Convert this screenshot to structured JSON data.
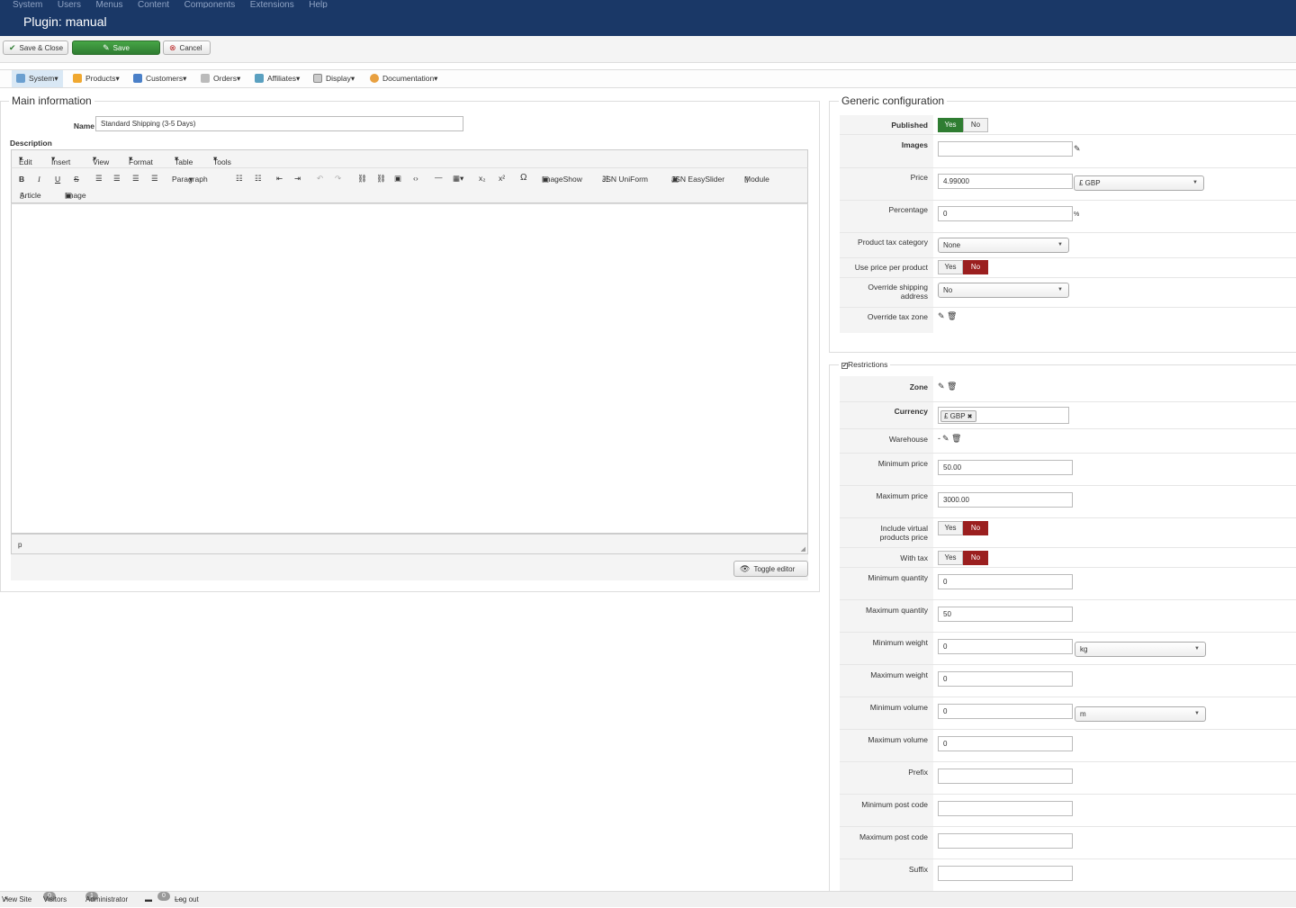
{
  "topmenu": [
    "System",
    "Users",
    "Menus",
    "Content",
    "Components",
    "Extensions",
    "Help"
  ],
  "page_title": "Plugin: manual",
  "toolbar": {
    "save_close": "Save & Close",
    "save": "Save",
    "cancel": "Cancel"
  },
  "submenu": [
    {
      "label": "System",
      "icon": "wrench-icon"
    },
    {
      "label": "Products",
      "icon": "box-icon"
    },
    {
      "label": "Customers",
      "icon": "users-icon"
    },
    {
      "label": "Orders",
      "icon": "orders-icon"
    },
    {
      "label": "Affiliates",
      "icon": "affiliates-icon"
    },
    {
      "label": "Display",
      "icon": "display-icon"
    },
    {
      "label": "Documentation",
      "icon": "documentation-icon"
    }
  ],
  "main": {
    "legend": "Main information",
    "name_label": "Name",
    "name_value": "Standard Shipping (3-5 Days)",
    "description_label": "Description",
    "editor_menu": [
      "Edit",
      "Insert",
      "View",
      "Format",
      "Table",
      "Tools"
    ],
    "editor_block_format": "Paragraph",
    "editor_plugins": [
      "ImageShow",
      "JSN UniForm",
      "JSN EasySlider",
      "Module"
    ],
    "editor_plugins2": [
      "Article",
      "Image"
    ],
    "editor_path": "p",
    "toggle_editor": "Toggle editor"
  },
  "generic": {
    "legend": "Generic configuration",
    "published_label": "Published",
    "yes": "Yes",
    "no": "No",
    "images_label": "Images",
    "price_label": "Price",
    "price_value": "4.99000",
    "price_currency": "£ GBP",
    "percentage_label": "Percentage",
    "percentage_value": "0",
    "percent_sign": "%",
    "tax_category_label": "Product tax category",
    "tax_category_value": "None",
    "use_price_per_product_label": "Use price per product",
    "override_shipping_label_1": "Override shipping",
    "override_shipping_label_2": "address",
    "override_shipping_value": "No",
    "override_tax_zone_label": "Override tax zone"
  },
  "restrictions": {
    "legend": "Restrictions",
    "zone_label": "Zone",
    "currency_label": "Currency",
    "currency_tag": "£ GBP",
    "warehouse_label": "Warehouse",
    "warehouse_value": "-",
    "min_price_label": "Minimum price",
    "min_price_value": "50.00",
    "max_price_label": "Maximum price",
    "max_price_value": "3000.00",
    "include_virtual_label_1": "Include virtual",
    "include_virtual_label_2": "products price",
    "with_tax_label": "With tax",
    "min_qty_label": "Minimum quantity",
    "min_qty_value": "0",
    "max_qty_label": "Maximum quantity",
    "max_qty_value": "50",
    "min_weight_label": "Minimum weight",
    "min_weight_value": "0",
    "weight_unit": "kg",
    "max_weight_label": "Maximum weight",
    "max_weight_value": "0",
    "min_volume_label": "Minimum volume",
    "min_volume_value": "0",
    "volume_unit": "m",
    "max_volume_label": "Maximum volume",
    "max_volume_value": "0",
    "prefix_label": "Prefix",
    "min_postcode_label": "Minimum post code",
    "max_postcode_label": "Maximum post code",
    "suffix_label": "Suffix"
  },
  "statusbar": {
    "view_site": "View Site",
    "visitors_count": "0",
    "visitors": "Visitors",
    "admin_count": "1",
    "administrator": "Administrator",
    "messages_count": "0",
    "logout": "Log out"
  }
}
